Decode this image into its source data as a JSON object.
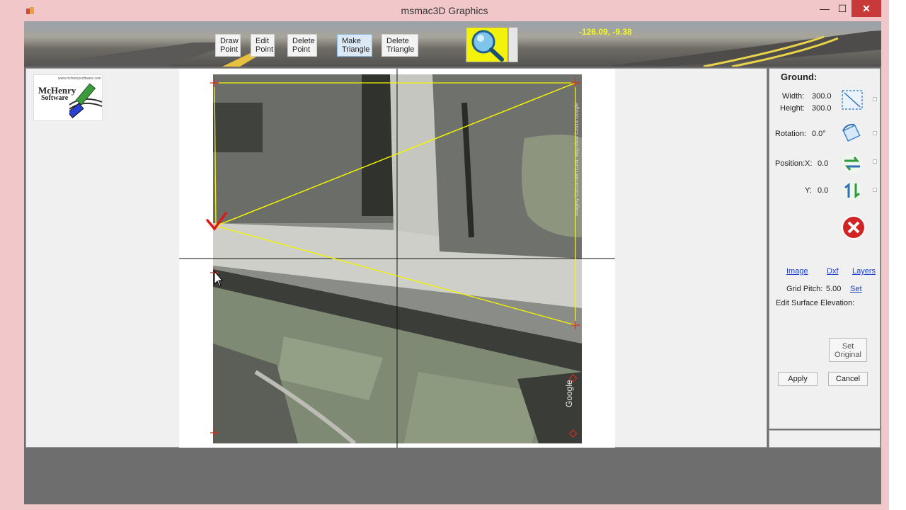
{
  "window": {
    "title": "msmac3D Graphics",
    "min_glyph": "—",
    "max_glyph": "☐",
    "close_glyph": "✕"
  },
  "toolbar": {
    "buttons": [
      {
        "label": "Draw\nPoint",
        "active": false
      },
      {
        "label": "Edit\nPoint",
        "active": false
      },
      {
        "label": "Delete\nPoint",
        "active": false
      },
      {
        "label": "Make\nTriangle",
        "active": true
      },
      {
        "label": "Delete\nTriangle",
        "active": false
      }
    ],
    "coordinates": "-126.09, -9.38",
    "zoom_icon": "magnifier-icon"
  },
  "logo": {
    "line1": "McHenry",
    "line2": "Software",
    "url": "www.mchenrysoftware.com"
  },
  "panel": {
    "heading": "Ground:",
    "width_label": "Width:",
    "width_value": "300.0",
    "height_label": "Height:",
    "height_value": "300.0",
    "rotation_label": "Rotation:",
    "rotation_value": "0.0°",
    "position_label": "Position:",
    "x_label": "X:",
    "x_value": "0.0",
    "y_label": "Y:",
    "y_value": "0.0",
    "links": [
      "Image",
      "Dxf",
      "Layers"
    ],
    "grid_pitch_label": "Grid Pitch:",
    "grid_pitch_value": "5.00",
    "grid_pitch_set": "Set",
    "edit_elevation_label": "Edit Surface Elevation:",
    "set_original_label": "Set\nOriginal",
    "apply_label": "Apply",
    "cancel_label": "Cancel"
  },
  "aerial_watermark": "Google",
  "aerial_copyright": "Imagery ©2014 METCAN, Map data ©2014 Google",
  "colors": {
    "triangle": "#f4f400",
    "title_bar": "#f2c7c9",
    "link": "#1a3fd0",
    "coords": "#f6f62c"
  }
}
